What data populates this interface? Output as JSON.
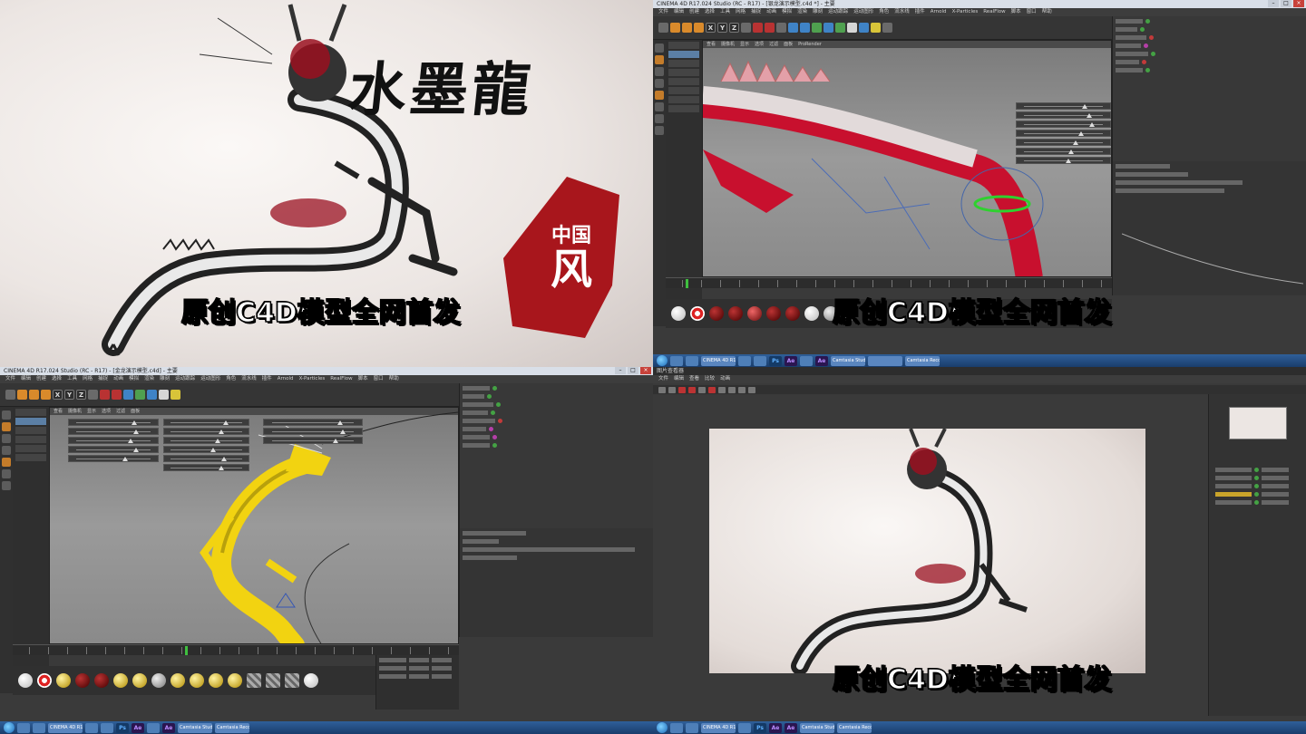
{
  "q1": {
    "title": "水墨龍",
    "seal_small": "中国",
    "seal_big": "风",
    "caption": "原创C4D模型全网首发"
  },
  "q2": {
    "window_title": "CINEMA 4D R17.024 Studio (RC - R17) - [银龙演示模型.c4d *] - 主要",
    "menus": [
      "文件",
      "编辑",
      "创建",
      "选择",
      "工具",
      "网格",
      "捕捉",
      "动画",
      "模拟",
      "渲染",
      "雕刻",
      "运动跟踪",
      "运动图形",
      "角色",
      "流水线",
      "插件",
      "Arnold",
      "X-Particles",
      "RealFlow",
      "脚本",
      "窗口",
      "帮助"
    ],
    "caption": "原创C4D模型全网首发"
  },
  "q3": {
    "window_title": "CINEMA 4D R17.024 Studio (RC - R17) - [金龙演示模型.c4d] - 主要",
    "menus": [
      "文件",
      "编辑",
      "创建",
      "选择",
      "工具",
      "网格",
      "捕捉",
      "动画",
      "模拟",
      "渲染",
      "雕刻",
      "运动跟踪",
      "运动图形",
      "角色",
      "流水线",
      "插件",
      "Arnold",
      "X-Particles",
      "RealFlow",
      "脚本",
      "窗口",
      "帮助"
    ],
    "axis_x": "X",
    "axis_y": "Y",
    "axis_z": "Z"
  },
  "q4": {
    "window_title": "图片查看器",
    "caption": "原创C4D模型全网首发"
  },
  "taskbar": {
    "app_labels": [
      "CINEMA 4D R17...",
      "Camtasia Studio...",
      "Camtasia Recor..."
    ]
  },
  "colors": {
    "seal_red": "#a8161c",
    "caption_fill": "#ffffff",
    "caption_stroke": "#000000",
    "dragon_red": "#c8102e",
    "dragon_gold": "#f2d311",
    "c4d_bg": "#3a3a3a"
  }
}
